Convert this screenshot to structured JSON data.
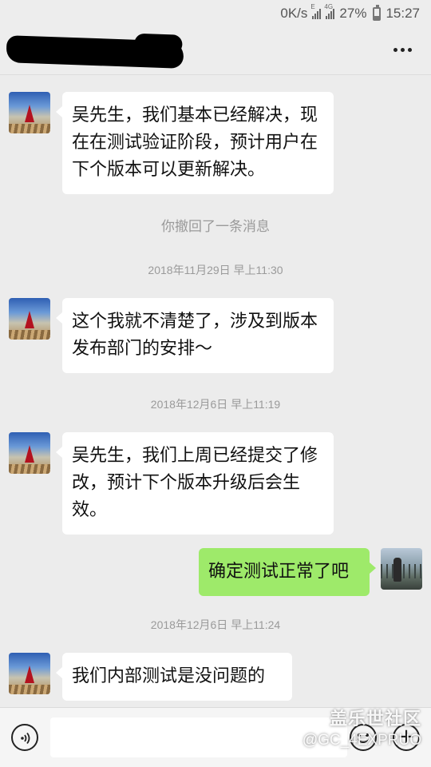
{
  "status_bar": {
    "speed": "0K/s",
    "signal_1_tag": "E",
    "signal_2_tag": "4G",
    "battery": "27%",
    "time": "15:27"
  },
  "header": {
    "title_redacted": true
  },
  "messages": [
    {
      "side": "left",
      "text": "吴先生，我们基本已经解决，现在在测试验证阶段，预计用户在下个版本可以更新解决。"
    },
    {
      "system": "你撤回了一条消息"
    },
    {
      "timestamp": "2018年11月29日 早上11:30"
    },
    {
      "side": "left",
      "text": "这个我就不清楚了，涉及到版本发布部门的安排～"
    },
    {
      "timestamp": "2018年12月6日 早上11:19"
    },
    {
      "side": "left",
      "text": "吴先生，我们上周已经提交了修改，预计下个版本升级后会生效。"
    },
    {
      "side": "right",
      "text": "确定测试正常了吧"
    },
    {
      "timestamp": "2018年12月6日 早上11:24"
    },
    {
      "side": "left",
      "text": "我们内部测试是没问题的"
    }
  ],
  "input": {
    "value": "",
    "placeholder": ""
  },
  "watermark": {
    "title": "盖乐世社区",
    "handle": "@GC_4EXPRUO"
  },
  "icons": {
    "more": "more-icon",
    "voice": "voice-icon",
    "emoji": "emoji-icon",
    "plus": "plus-icon"
  },
  "colors": {
    "sent_bubble": "#9eea6a",
    "received_bubble": "#ffffff",
    "chat_background": "#ececec"
  }
}
